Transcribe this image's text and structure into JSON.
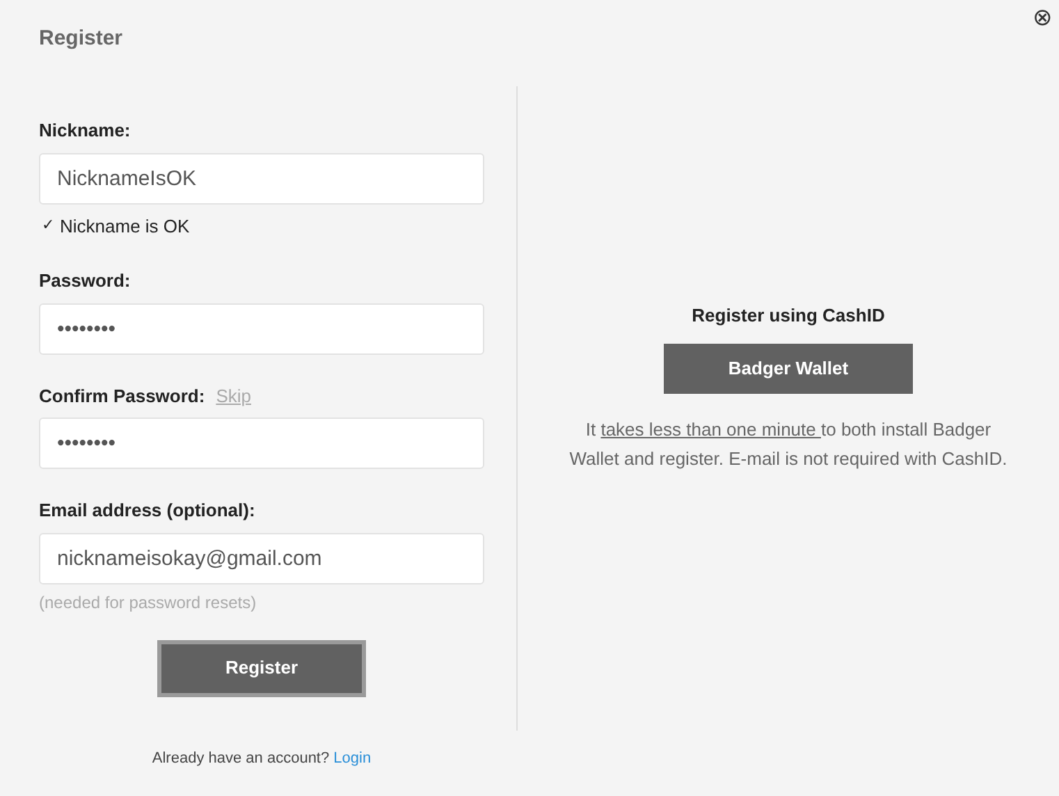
{
  "title": "Register",
  "close": {
    "label": "⊗"
  },
  "fields": [
    {
      "label": "Nickname:",
      "value": "NicknameIsOK",
      "status": {
        "icon": "✓",
        "text": "Nickname is OK"
      }
    },
    {
      "label": "Password:",
      "value": "••••••••"
    },
    {
      "label": "Confirm Password:",
      "link": "Skip",
      "value": "••••••••"
    },
    {
      "label": "Email address (optional):",
      "value": "nicknameisokay@gmail.com",
      "hint": "(needed for password resets)"
    }
  ],
  "register_button": "Register",
  "login_prompt": {
    "text": "Already have an account?",
    "link": "Login"
  },
  "cashid": {
    "heading": "Register using CashID",
    "button": "Badger Wallet",
    "note_before": "It",
    "note_link": "takes less than one minute ",
    "note_after": "to both install Badger Wallet and register. E-mail is not required with CashID."
  }
}
